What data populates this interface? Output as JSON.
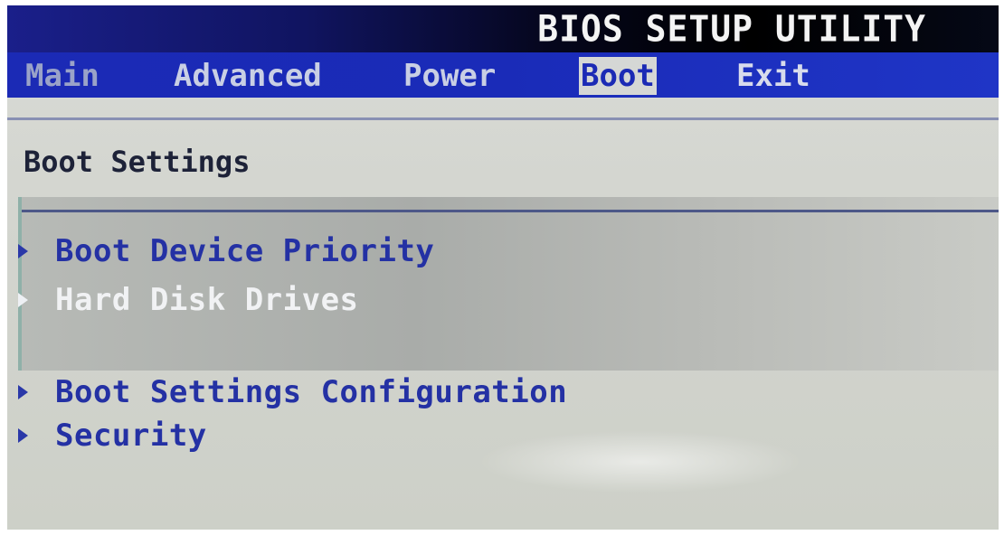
{
  "title": "BIOS SETUP UTILITY",
  "menu": {
    "items": [
      {
        "label": "Main"
      },
      {
        "label": "Advanced"
      },
      {
        "label": "Power"
      },
      {
        "label": "Boot"
      },
      {
        "label": "Exit"
      }
    ],
    "active": "Boot"
  },
  "section_title": "Boot Settings",
  "entries": [
    {
      "label": "Boot Device Priority",
      "icon": "submenu-arrow-icon"
    },
    {
      "label": "Hard Disk Drives",
      "icon": "submenu-arrow-icon"
    },
    {
      "label": "Boot Settings Configuration",
      "icon": "submenu-arrow-icon"
    },
    {
      "label": "Security",
      "icon": "submenu-arrow-icon"
    }
  ],
  "selected_entry": "Hard Disk Drives",
  "colors": {
    "menu_bar": "#1b2ab5",
    "entry_text": "#2431a4",
    "selected_text": "#f1f2f4",
    "background": "#d5d7d5"
  }
}
